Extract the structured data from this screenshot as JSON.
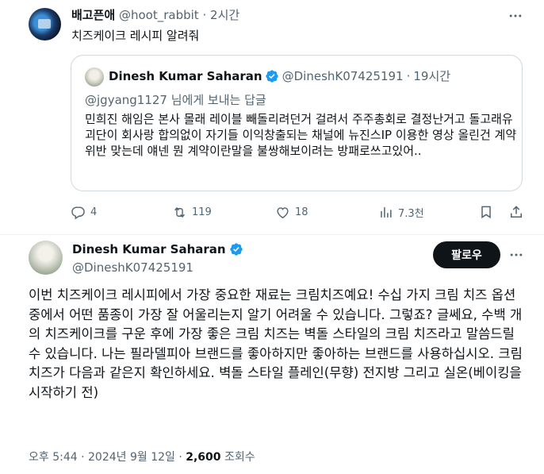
{
  "tweet": {
    "display_name": "배고픈애",
    "handle": "@hoot_rabbit",
    "separator": "·",
    "time": "2시간",
    "text": "치즈케이크 레시피 알려줘",
    "quote": {
      "display_name": "Dinesh Kumar Saharan",
      "handle": "@DineshK07425191",
      "separator": "·",
      "time": "19시간",
      "reply_mention": "@jgyang1127",
      "reply_suffix": " 님에게 보내는 답글",
      "body": "민희진 해임은 본사 몰래 레이블 빼돌리려던거 걸려서 주주총회로 결정난거고 돌고래유괴단이 회사랑 합의없이 자기들 이익창출되는 채널에 뉴진스IP 이용한 영상 올린건 계약위반 맞는데 얘넨 뭔 계약이란말을 불쌍해보이려는 방패로쓰고있어.."
    },
    "actions": {
      "replies": "4",
      "reposts": "119",
      "likes": "18",
      "views": "7.3천"
    }
  },
  "reply_tweet": {
    "display_name": "Dinesh Kumar Saharan",
    "handle": "@DineshK07425191",
    "follow_label": "팔로우",
    "text": "이번 치즈케이크 레시피에서 가장 중요한 재료는 크림치즈예요! 수십 가지 크림 치즈 옵션 중에서 어떤 품종이 가장 잘 어울리는지 알기 어려울 수 있습니다. 그렇죠? 글쎄요, 수백 개의 치즈케이크를 구운 후에 가장 좋은 크림 치즈는 벽돌 스타일의 크림 치즈라고 말씀드릴 수 있습니다. 나는 필라델피아 브랜드를 좋아하지만 좋아하는 브랜드를 사용하십시오. 크림 치즈가 다음과 같은지 확인하세요. 벽돌 스타일 플레인(무향) 전지방 그리고 실온(베이킹을 시작하기 전)",
    "timestamp": "오후 5:44 · 2024년 9월 12일",
    "meta_sep": " · ",
    "views_count": "2,600",
    "views_label": " 조회수"
  },
  "colors": {
    "text": "#0f1419",
    "secondary": "#536471",
    "border": "#cfd9de",
    "verified": "#1d9bf0",
    "button_bg": "#0f1419"
  },
  "icons": [
    "more-icon",
    "verified-badge-icon",
    "reply-icon",
    "repost-icon",
    "like-icon",
    "views-icon",
    "bookmark-icon",
    "share-icon"
  ]
}
